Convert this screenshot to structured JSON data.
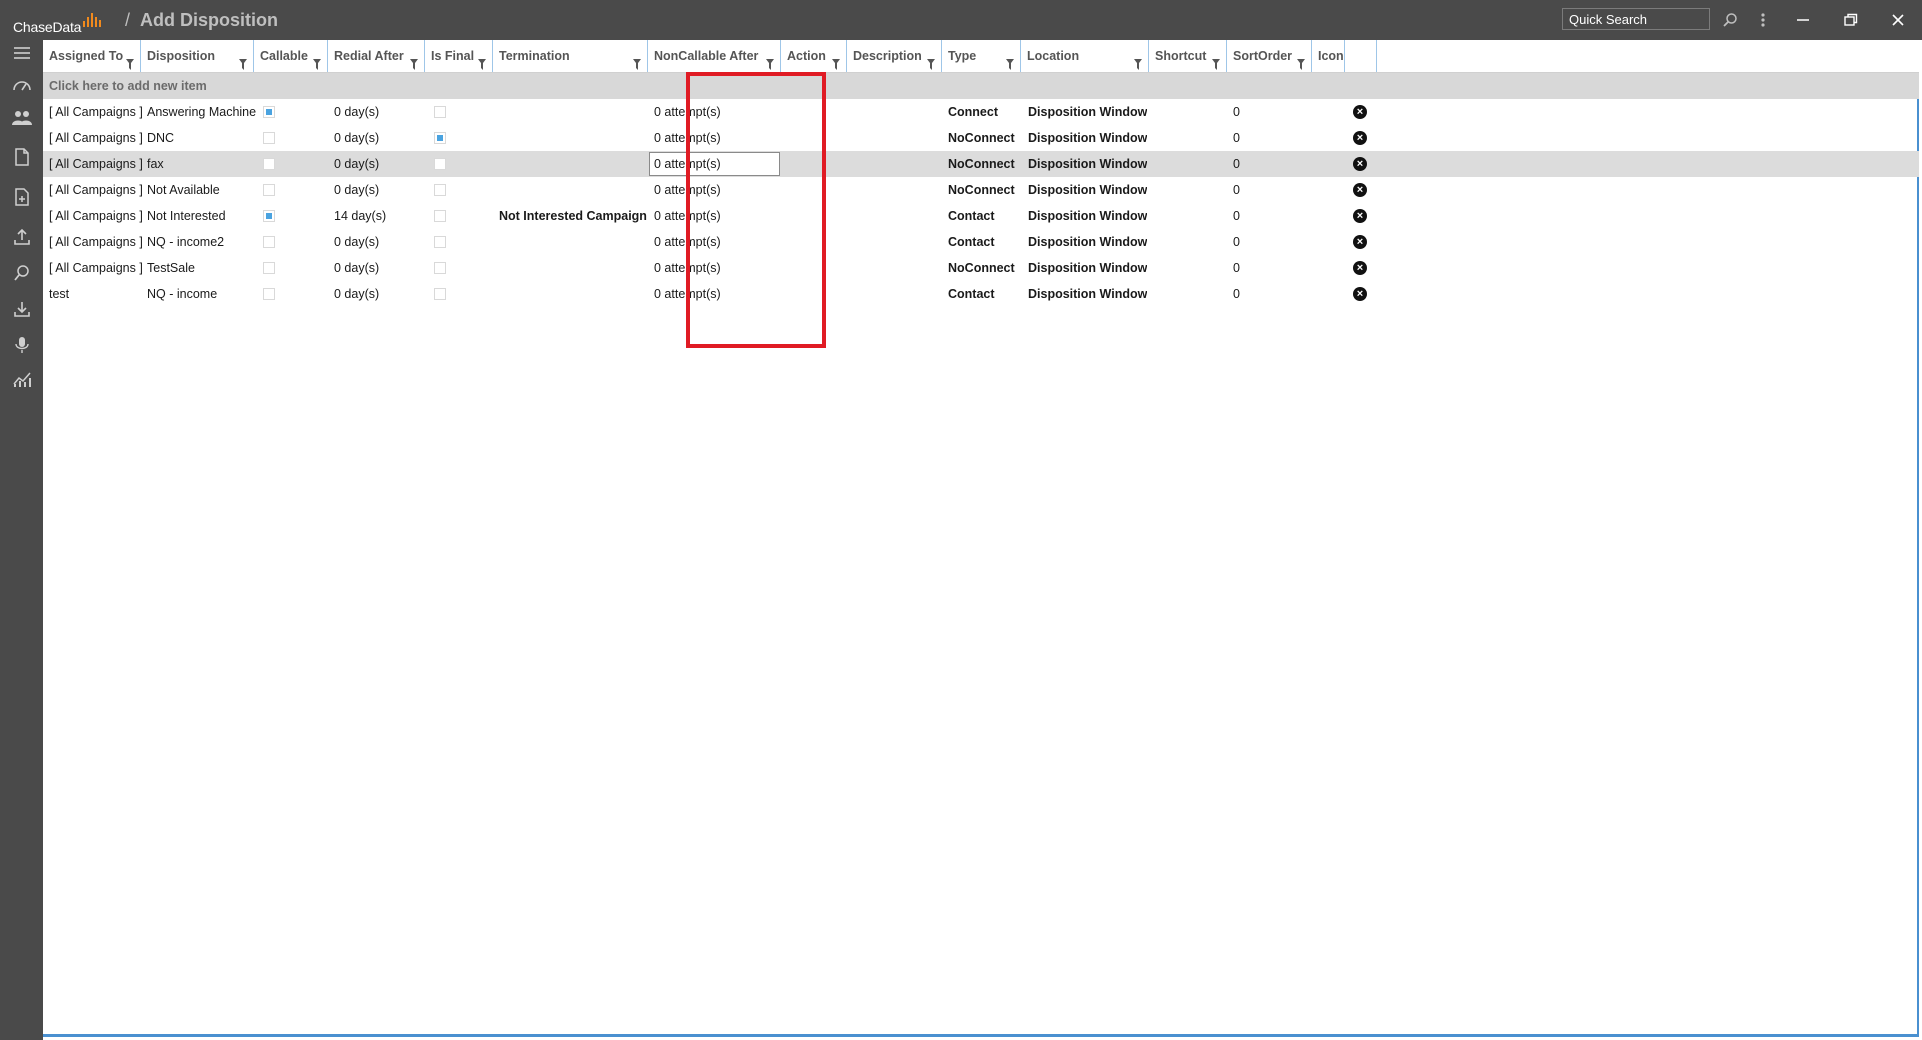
{
  "app": {
    "logo": "ChaseData",
    "page_title": "Add Disposition",
    "breadcrumb_separator": "/"
  },
  "titlebar": {
    "search_placeholder": "Quick Search"
  },
  "grid": {
    "columns": [
      "Assigned To",
      "Disposition",
      "Callable",
      "Redial After",
      "Is Final",
      "Termination",
      "NonCallable After",
      "Action",
      "Description",
      "Type",
      "Location",
      "Shortcut",
      "SortOrder",
      "Icon"
    ],
    "add_row_text": "Click here to add new item",
    "rows": [
      {
        "assigned_to": "[ All Campaigns ]",
        "disposition": "Answering Machine",
        "callable": true,
        "redial_after": "0 day(s)",
        "is_final": false,
        "termination": "",
        "noncallable_after": "0 attempt(s)",
        "type": "Connect",
        "location": "Disposition Window",
        "sort_order": "0"
      },
      {
        "assigned_to": "[ All Campaigns ]",
        "disposition": "DNC",
        "callable": false,
        "redial_after": "0 day(s)",
        "is_final": true,
        "termination": "",
        "noncallable_after": "0 attempt(s)",
        "type": "NoConnect",
        "location": "Disposition Window",
        "sort_order": "0"
      },
      {
        "assigned_to": "[ All Campaigns ]",
        "disposition": "fax",
        "callable": false,
        "redial_after": "0 day(s)",
        "is_final": false,
        "termination": "",
        "noncallable_after": "0 attempt(s)",
        "type": "NoConnect",
        "location": "Disposition Window",
        "sort_order": "0"
      },
      {
        "assigned_to": "[ All Campaigns ]",
        "disposition": "Not Available",
        "callable": false,
        "redial_after": "0 day(s)",
        "is_final": false,
        "termination": "",
        "noncallable_after": "0 attempt(s)",
        "type": "NoConnect",
        "location": "Disposition Window",
        "sort_order": "0"
      },
      {
        "assigned_to": "[ All Campaigns ]",
        "disposition": "Not Interested",
        "callable": true,
        "redial_after": "14 day(s)",
        "is_final": false,
        "termination": "Not Interested Campaign",
        "noncallable_after": "0 attempt(s)",
        "type": "Contact",
        "location": "Disposition Window",
        "sort_order": "0"
      },
      {
        "assigned_to": "[ All Campaigns ]",
        "disposition": "NQ - income2",
        "callable": false,
        "redial_after": "0 day(s)",
        "is_final": false,
        "termination": "",
        "noncallable_after": "0 attempt(s)",
        "type": "Contact",
        "location": "Disposition Window",
        "sort_order": "0"
      },
      {
        "assigned_to": "[ All Campaigns ]",
        "disposition": "TestSale",
        "callable": false,
        "redial_after": "0 day(s)",
        "is_final": false,
        "termination": "",
        "noncallable_after": "0 attempt(s)",
        "type": "NoConnect",
        "location": "Disposition Window",
        "sort_order": "0"
      },
      {
        "assigned_to": "test",
        "disposition": "NQ - income",
        "callable": false,
        "redial_after": "0 day(s)",
        "is_final": false,
        "termination": "",
        "noncallable_after": "0 attempt(s)",
        "type": "Contact",
        "location": "Disposition Window",
        "sort_order": "0"
      }
    ]
  },
  "colors": {
    "chrome": "#4a4a4a",
    "accent": "#4a90d0",
    "highlight": "#e01b24",
    "logo_bars": "#f18a1d"
  },
  "icons": {
    "rail": [
      "menu-icon",
      "dashboard-icon",
      "users-icon",
      "document-icon",
      "add-document-icon",
      "upload-icon",
      "search-icon",
      "download-icon",
      "microphone-icon",
      "chart-icon"
    ],
    "titlebar": [
      "search-icon",
      "more-icon",
      "minimize-icon",
      "restore-icon",
      "close-icon"
    ],
    "row": "delete-icon"
  }
}
